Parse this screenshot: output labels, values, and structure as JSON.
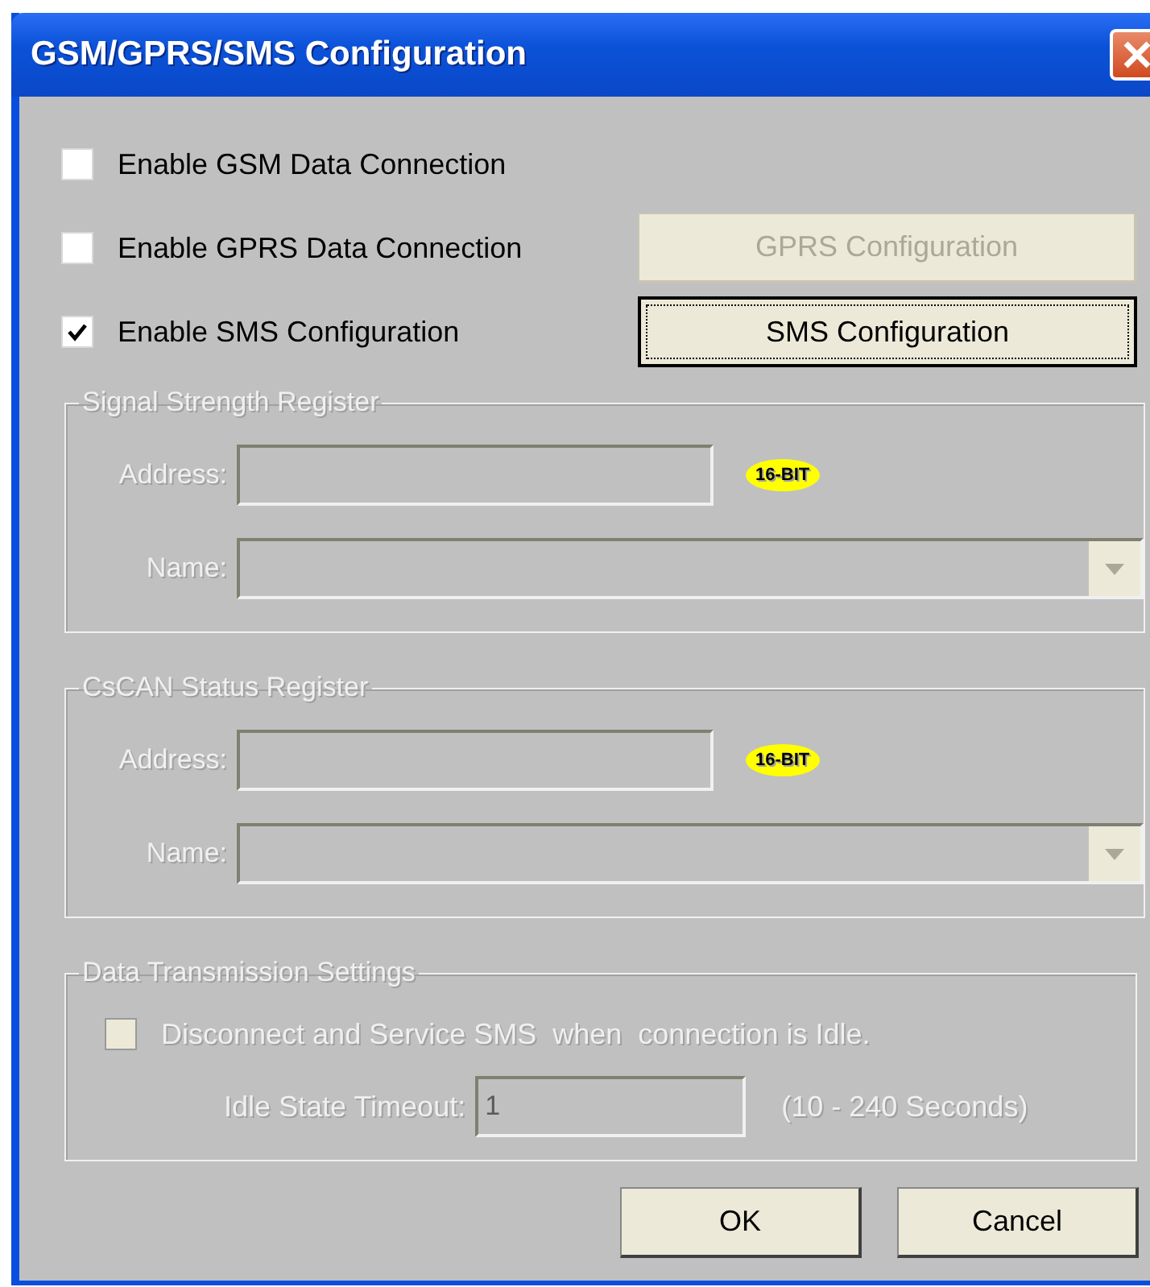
{
  "window": {
    "title": "GSM/GPRS/SMS Configuration"
  },
  "options": [
    {
      "label": "Enable GSM Data Connection",
      "checked": false
    },
    {
      "label": "Enable GPRS Data Connection",
      "checked": false,
      "button": {
        "label": "GPRS Configuration",
        "disabled": true,
        "focused": false
      }
    },
    {
      "label": "Enable SMS Configuration",
      "checked": true,
      "button": {
        "label": "SMS Configuration",
        "disabled": false,
        "focused": true
      }
    }
  ],
  "groups": [
    {
      "title": "Signal Strength Register",
      "disabled": true,
      "address_label": "Address:",
      "badge": "16-BIT",
      "name_label": "Name:"
    },
    {
      "title": "CsCAN Status Register",
      "disabled": true,
      "address_label": "Address:",
      "badge": "16-BIT",
      "name_label": "Name:"
    }
  ],
  "transmission": {
    "title": "Data Transmission Settings",
    "disabled": true,
    "option": {
      "label": "Disconnect and Service SMS  when  connection is Idle.",
      "checked": false
    },
    "timeout_label": "Idle State Timeout:",
    "timeout_value": "1",
    "range": "(10 - 240 Seconds)"
  },
  "dialog_buttons": [
    {
      "label": "OK"
    },
    {
      "label": "Cancel"
    }
  ]
}
